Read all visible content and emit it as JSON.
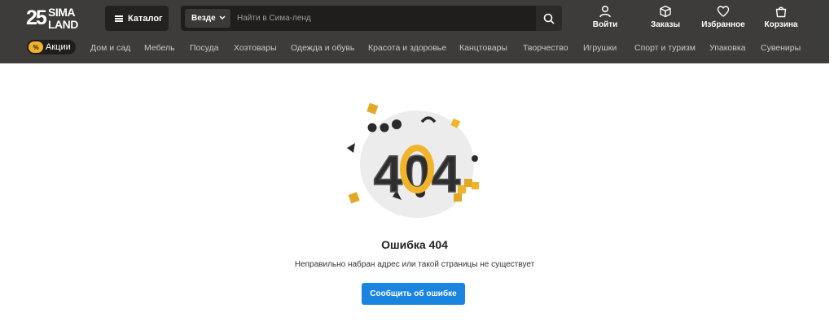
{
  "header": {
    "logo_number": "25",
    "logo_word_top": "SIMA",
    "logo_word_bottom": "LAND",
    "catalog_label": "Каталог",
    "search_scope": "Везде",
    "search_placeholder": "Найти в Сима-ленд",
    "actions": [
      {
        "label": "Войти",
        "icon": "user-icon"
      },
      {
        "label": "Заказы",
        "icon": "box-icon"
      },
      {
        "label": "Избранное",
        "icon": "heart-icon"
      },
      {
        "label": "Корзина",
        "icon": "bag-icon"
      }
    ]
  },
  "nav": {
    "promo_badge": "%",
    "promo_label": "Акции",
    "categories": [
      "Дом и сад",
      "Мебель",
      "Посуда",
      "Хозтовары",
      "Одежда и обувь",
      "Красота и здоровье",
      "Канцтовары",
      "Творчество",
      "Игрушки",
      "Спорт и туризм",
      "Упаковка",
      "Сувениры"
    ]
  },
  "main": {
    "illustration_text": "404",
    "title": "Ошибка 404",
    "description": "Неправильно набран адрес или такой страницы не существует",
    "report_button": "Сообщить об ошибке"
  },
  "colors": {
    "header_bg": "#3d3c3b",
    "accent_gold": "#f1b32a",
    "button_blue": "#1a85e0"
  }
}
